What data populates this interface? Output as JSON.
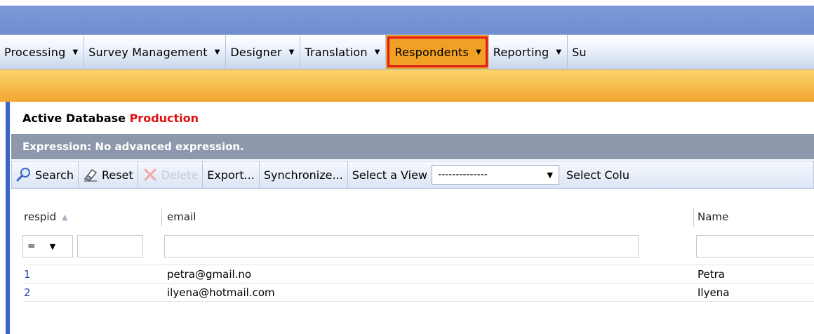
{
  "menu": {
    "items": [
      {
        "label": "Processing"
      },
      {
        "label": "Survey Management"
      },
      {
        "label": "Designer"
      },
      {
        "label": "Translation"
      },
      {
        "label": "Respondents",
        "active": true
      },
      {
        "label": "Reporting"
      },
      {
        "label": "Su"
      }
    ]
  },
  "database": {
    "label": "Active Database",
    "value": "Production"
  },
  "expression": "Expression: No advanced expression.",
  "toolbar": {
    "search": "Search",
    "reset": "Reset",
    "delete": "Delete",
    "export": "Export...",
    "synchronize": "Synchronize...",
    "select_view_label": "Select a View",
    "select_view_value": "--------------",
    "select_columns": "Select Colu"
  },
  "grid": {
    "columns": [
      "respid",
      "email",
      "Name"
    ],
    "filter_operator": "=",
    "rows": [
      {
        "respid": "1",
        "email": "petra@gmail.no",
        "name": "Petra"
      },
      {
        "respid": "2",
        "email": "ilyena@hotmail.com",
        "name": "Ilyena"
      }
    ]
  },
  "colors": {
    "accent_red": "#e01010",
    "active_menu": "#f0a024",
    "left_bar": "#3b64c6"
  }
}
